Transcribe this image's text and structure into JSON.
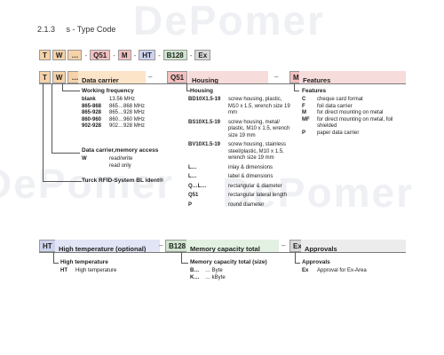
{
  "section": {
    "number": "2.1.3",
    "title": "s - Type Code"
  },
  "code_row": [
    "T",
    "W",
    "…",
    "-",
    "Q51",
    "-",
    "M",
    "-",
    "HT",
    "-",
    "B128",
    "-",
    "Ex"
  ],
  "watermark": "DePomer",
  "data_carrier": {
    "header_code": [
      "T",
      "W",
      "…"
    ],
    "label": "Data carrier",
    "working_frequency_title": "Working frequency",
    "frequencies": [
      {
        "code": "blank",
        "value": "13.56 MHz"
      },
      {
        "code": "865-868",
        "value": "865…868 MHz"
      },
      {
        "code": "865-928",
        "value": "865…928 MHz"
      },
      {
        "code": "860-960",
        "value": "860…960 MHz"
      },
      {
        "code": "902-928",
        "value": "902…928 MHz"
      }
    ],
    "memory_access_title": "Data carrier,memory access",
    "access": [
      {
        "code": "W",
        "value": "read/write"
      },
      {
        "code": "",
        "value": "read only"
      }
    ],
    "system_note": "Turck RFID-System BL ident®"
  },
  "housing": {
    "header_code": "Q51",
    "label": "Housing",
    "title": "Housing",
    "items": [
      {
        "code": "BD10X1.5-19",
        "value": "screw housing, plastic, M10 x 1.5, wrench size 19 mm"
      },
      {
        "code": "BS10X1.5-19",
        "value": "screw housing, metal/ plastic, M10 x 1.5, wrench size 19 mm"
      },
      {
        "code": "BV10X1.5-19",
        "value": "screw housing, stainless steel/plastic, M10 x 1.5, wrench size 19 mm"
      },
      {
        "code": "L…",
        "value": "inlay & dimensions"
      },
      {
        "code": "L…",
        "value": "label & dimensions"
      },
      {
        "code": "Q…L…",
        "value": "rectangular & diameter"
      },
      {
        "code": "Q51",
        "value": "rectangular lateral length"
      },
      {
        "code": "P",
        "value": "round diameter"
      }
    ]
  },
  "features": {
    "header_code": "M",
    "label": "Features",
    "title": "Features",
    "items": [
      {
        "code": "C",
        "value": "cheque card format"
      },
      {
        "code": "F",
        "value": "foil data carrier"
      },
      {
        "code": "M",
        "value": "for direct mounting on metal"
      },
      {
        "code": "MF",
        "value": "for direct mounting on metal, foil shielded"
      },
      {
        "code": "P",
        "value": "paper data carrier"
      }
    ]
  },
  "high_temp": {
    "header_code": "HT",
    "label": "High temperature (optional)",
    "title": "High temperature",
    "items": [
      {
        "code": "HT",
        "value": "High temperature"
      }
    ]
  },
  "memory": {
    "header_code": "B128",
    "label": "Memory capacity total",
    "title": "Memory capacity total (size)",
    "items": [
      {
        "code": "B…",
        "value": "… Byte"
      },
      {
        "code": "K…",
        "value": "… kByte"
      }
    ]
  },
  "approvals": {
    "header_code": "Ex",
    "label": "Approvals",
    "title": "Approvals",
    "items": [
      {
        "code": "Ex",
        "value": "Approval for Ex-Area"
      }
    ]
  }
}
